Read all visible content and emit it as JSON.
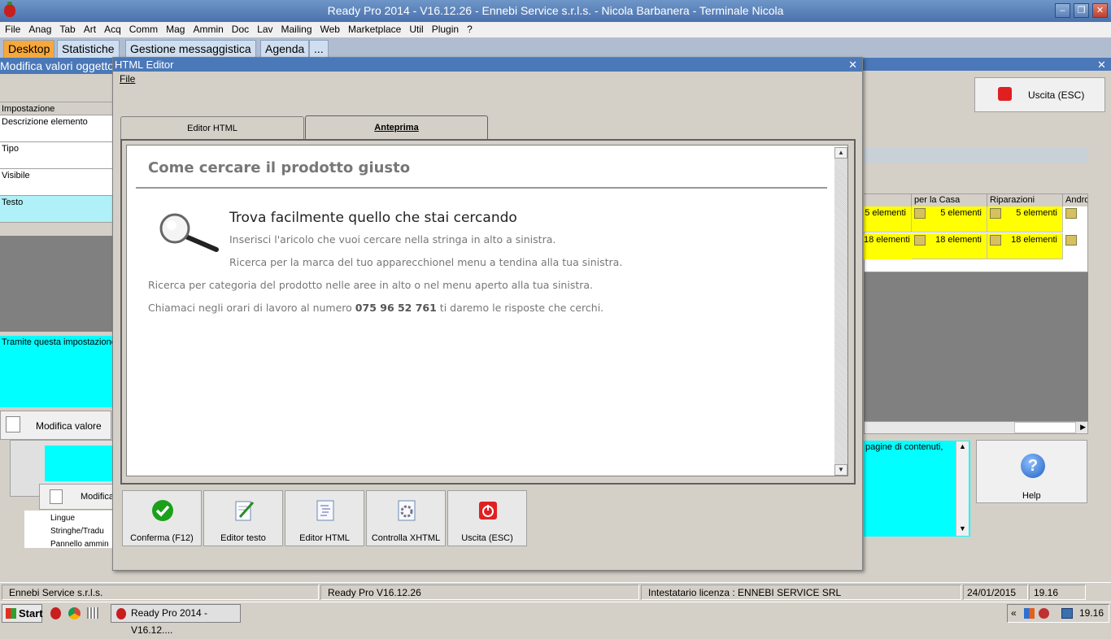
{
  "window": {
    "title": "Ready Pro 2014 - V16.12.26 - Ennebi Service s.r.l.s. - Nicola Barbanera - Terminale Nicola",
    "min": "–",
    "restore": "❐",
    "close": "✕"
  },
  "menu": [
    "File",
    "Anag",
    "Tab",
    "Art",
    "Acq",
    "Comm",
    "Mag",
    "Ammin",
    "Doc",
    "Lav",
    "Mailing",
    "Web",
    "Marketplace",
    "Util",
    "Plugin",
    "?"
  ],
  "tabs": [
    "Desktop",
    "Statistiche",
    "Gestione messaggistica",
    "Agenda",
    "..."
  ],
  "bg_left": {
    "header": "Modifica valori oggetto",
    "rows": [
      "Impostazione",
      "Descrizione elemento",
      "Tipo",
      "Visibile",
      "Testo"
    ],
    "desc": "Tramite questa impostazione",
    "modify_btn": "Modifica valore",
    "modify_btn2": "Modifica",
    "tree": [
      "Lingue",
      "Stringhe/Tradu",
      "Pannello ammin"
    ]
  },
  "bg_right": {
    "exit_btn": "Uscita (ESC)",
    "columns": [
      "per la Casa",
      "Riparazioni",
      "Andro"
    ],
    "rows": [
      [
        "5 elementi",
        "5 elementi",
        "5 elementi"
      ],
      [
        "18 elementi",
        "18 elementi",
        "18 elementi"
      ]
    ],
    "note": "pagine di contenuti,",
    "help_btn": "Help"
  },
  "editor": {
    "title": "HTML Editor",
    "menu_file": "File",
    "tab_html": "Editor HTML",
    "tab_preview": "Anteprima",
    "preview": {
      "title": "Come cercare il prodotto giusto",
      "heading": "Trova facilmente quello che stai cercando",
      "p1": "Inserisci l'aricolo che vuoi cercare nella stringa in alto a sinistra.",
      "p2": "Ricerca per la marca del tuo apparecchionel menu a tendina alla tua sinistra.",
      "p3": "Ricerca per categoria del prodotto nelle aree in alto o nel menu aperto alla tua sinistra.",
      "p4_a": "Chiamaci negli orari di lavoro al numero ",
      "p4_b": "075 96 52 761",
      "p4_c": " ti daremo le risposte che cerchi."
    },
    "buttons": [
      "Conferma (F12)",
      "Editor testo",
      "Editor HTML",
      "Controlla XHTML",
      "Uscita (ESC)"
    ]
  },
  "status": {
    "company": "Ennebi Service s.r.l.s.",
    "version": "Ready Pro V16.12.26",
    "license": "Intestatario licenza : ENNEBI SERVICE SRL",
    "date": "24/01/2015",
    "time": "19.16"
  },
  "taskbar": {
    "start": "Start",
    "task": "Ready Pro 2014 - V16.12....",
    "clock": "19.16",
    "chevron": "«"
  }
}
